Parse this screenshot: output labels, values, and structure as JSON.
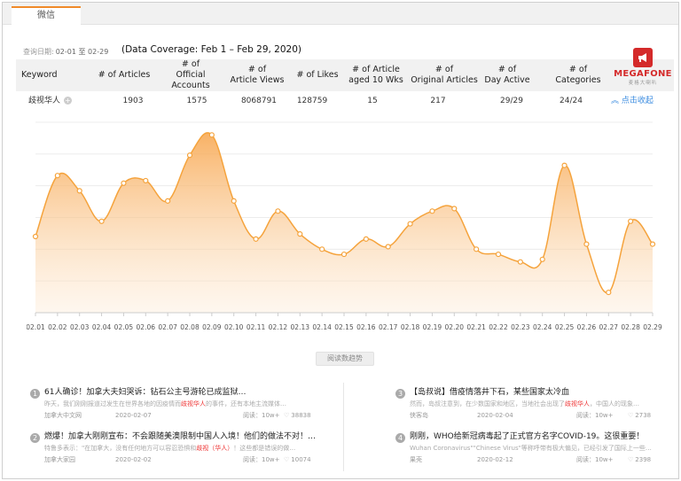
{
  "tab": {
    "label": "微信"
  },
  "query": {
    "label": "查询日期:",
    "range": "02-01 至 02-29"
  },
  "coverage": "(Data Coverage: Feb 1 – Feb 29, 2020)",
  "logo": {
    "name": "MEGAFONE",
    "sub": "麦格大喇叭"
  },
  "table": {
    "headers": [
      "Keyword",
      "# of Articles",
      "# of\nOfficial Accounts",
      "# of\nArticle Views",
      "# of Likes",
      "# of Article\naged 10 Wks",
      "# of\nOriginal Articles",
      "# of\nDay Active",
      "# of\nCategories"
    ],
    "row": {
      "keyword": "歧视华人",
      "articles": "1903",
      "accounts": "1575",
      "views": "8068791",
      "likes": "128759",
      "aged": "15",
      "original": "217",
      "day_active": "29/29",
      "categories": "24/24"
    },
    "collapse_label": "点击收起"
  },
  "trend_button": "阅读数趋势",
  "chart_data": {
    "type": "area",
    "x": [
      "02.01",
      "02.02",
      "02.03",
      "02.04",
      "02.05",
      "02.06",
      "02.07",
      "02.08",
      "02.09",
      "02.10",
      "02.11",
      "02.12",
      "02.13",
      "02.14",
      "02.15",
      "02.16",
      "02.17",
      "02.18",
      "02.19",
      "02.20",
      "02.21",
      "02.22",
      "02.23",
      "02.24",
      "02.25",
      "02.26",
      "02.27",
      "02.28",
      "02.29"
    ],
    "values": [
      3.0,
      5.4,
      4.8,
      3.6,
      5.1,
      5.2,
      4.4,
      6.2,
      7.0,
      4.4,
      2.9,
      4.0,
      3.1,
      2.5,
      2.3,
      2.9,
      2.6,
      3.5,
      4.0,
      4.1,
      2.5,
      2.3,
      2.0,
      2.1,
      5.8,
      2.7,
      0.8,
      3.6,
      2.7
    ],
    "ylim": [
      0,
      7.5
    ],
    "grid": true,
    "color": "#f5a33c"
  },
  "articles": [
    {
      "num": "1",
      "title": "61人确诊！加拿大夫妇哭诉：钻石公主号游轮已成监狱…",
      "snippet_pre": "昨天，我们刚刚报道过发生在世界各地的因疫情而",
      "snippet_hl": "歧视华人",
      "snippet_post": "的事件，还有本地主流媒体…",
      "source": "加拿大中文网",
      "date": "2020-02-07",
      "reads": "阅读：10w+",
      "likes": "38838"
    },
    {
      "num": "2",
      "title": "燃爆！加拿大刚刚宣布：不会跟随美澳限制中国人入境！他们的做法不对！…",
      "snippet_pre": "特鲁多表示：\"在加拿大，没有任何地方可以容忍恐惧和",
      "snippet_hl": "歧视（华人）",
      "snippet_post": "！这些都是错误的做…",
      "source": "加拿大家园",
      "date": "2020-02-02",
      "reads": "阅读：10w+",
      "likes": "10074"
    },
    {
      "num": "3",
      "title": "【岛叔说】借疫情落井下石，某些国家太冷血",
      "snippet_pre": "然而，岛叔注意到，在少数国家和地区，当地社会出现了",
      "snippet_hl": "歧视华人",
      "snippet_post": "，中国人的现象…",
      "source": "侠客岛",
      "date": "2020-02-04",
      "reads": "阅读：10w+",
      "likes": "2738"
    },
    {
      "num": "4",
      "title": "刚刚，WHO给新冠病毒起了正式官方名字COVID-19。这很重要！",
      "snippet_pre": "Wuhan Coronavirus\"\"Chinese Virus\"等称呼带有极大偏见，已经引发了国际上一些…",
      "snippet_hl": "",
      "snippet_post": "",
      "source": "果壳",
      "date": "2020-02-12",
      "reads": "阅读：10w+",
      "likes": "2398"
    }
  ]
}
